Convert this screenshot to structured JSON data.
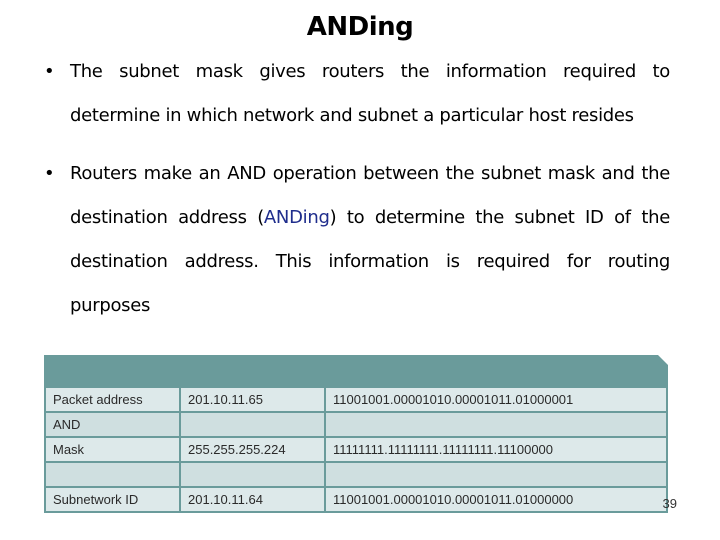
{
  "title": "ANDing",
  "bullets": [
    {
      "text": "The subnet mask gives routers the information required to determine in which network and subnet a particular host resides"
    },
    {
      "text_before": "Routers make an AND operation between the subnet mask and the destination address (",
      "highlight": "ANDing",
      "text_after": ") to determine the subnet ID of the destination address. This information is required for routing purposes"
    }
  ],
  "bullet_glyph": "•",
  "table": {
    "rows": [
      {
        "label": "Packet address",
        "decimal": "201.10.11.65",
        "binary": "11001001.00001010.00001011.01000001"
      },
      {
        "label": "AND",
        "decimal": "",
        "binary": ""
      },
      {
        "label": "Mask",
        "decimal": "255.255.255.224",
        "binary": "11111111.11111111.11111111.11100000"
      },
      {
        "label": "",
        "decimal": "",
        "binary": ""
      },
      {
        "label": "Subnetwork ID",
        "decimal": "201.10.11.64",
        "binary": "11001001.00001010.00001011.01000000"
      }
    ]
  },
  "colors": {
    "highlight": "#1f2d8c",
    "table_header": "#6a9b9b"
  },
  "page_number": "39"
}
